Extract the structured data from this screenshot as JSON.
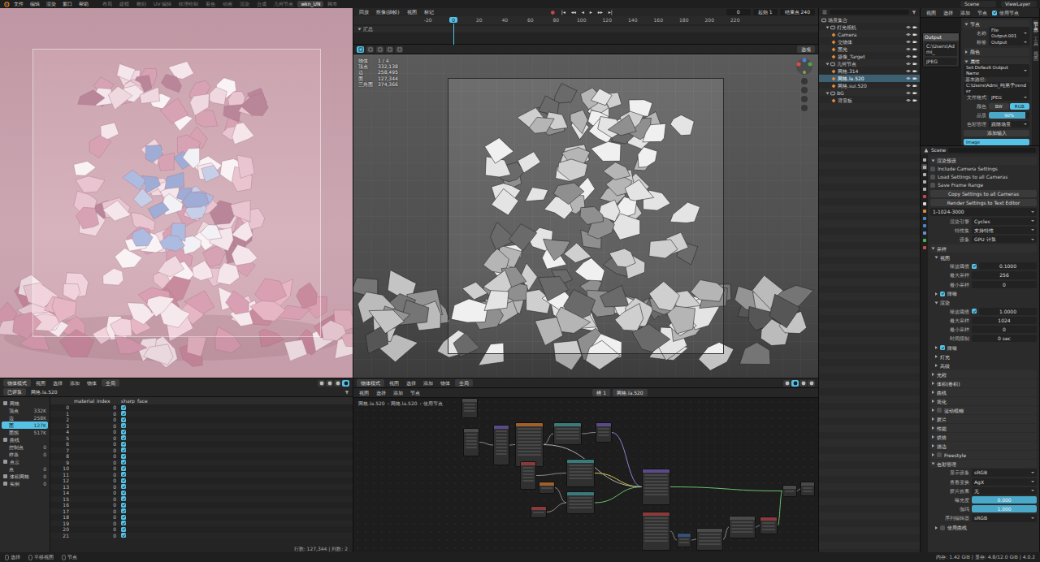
{
  "menubar": {
    "menus": [
      "文件",
      "编辑",
      "渲染",
      "窗口",
      "帮助"
    ],
    "workspaces": [
      {
        "label": "布局",
        "selected": false
      },
      {
        "label": "建模",
        "selected": false
      },
      {
        "label": "雕刻",
        "selected": false
      },
      {
        "label": "UV 编辑",
        "selected": false
      },
      {
        "label": "纹理绘制",
        "selected": false
      },
      {
        "label": "着色",
        "selected": false
      },
      {
        "label": "动画",
        "selected": false
      },
      {
        "label": "渲染",
        "selected": false
      },
      {
        "label": "合成",
        "selected": false
      },
      {
        "label": "几何节点",
        "selected": false
      },
      {
        "label": "wkn_UN",
        "selected": true
      },
      {
        "label": "脚本",
        "selected": false
      }
    ],
    "scene": "Scene",
    "view_layer": "ViewLayer"
  },
  "render_view": {
    "header": {
      "mode": "物体模式",
      "menus": [
        "视图",
        "选择",
        "添加",
        "物体"
      ],
      "orientation": "全局",
      "shading": [
        {
          "selected": false
        },
        {
          "selected": false
        },
        {
          "selected": false
        },
        {
          "selected": true
        }
      ]
    }
  },
  "timeline": {
    "menus": [
      "回放",
      "抠像(插帧)",
      "视图",
      "标记"
    ],
    "record": "●",
    "transport": [
      "|◂",
      "◂◂",
      "◂",
      "▸",
      "▸▸",
      "▸|"
    ],
    "current_frame": "0",
    "start_label": "起始",
    "start": "1",
    "end_label": "结束点",
    "end": "240",
    "summary": "汇总",
    "ruler": [
      {
        "label": "-20",
        "selected": false
      },
      {
        "label": "0",
        "selected": true
      },
      {
        "label": "20",
        "selected": false
      },
      {
        "label": "40",
        "selected": false
      },
      {
        "label": "60",
        "selected": false
      },
      {
        "label": "80",
        "selected": false
      },
      {
        "label": "100",
        "selected": false
      },
      {
        "label": "120",
        "selected": false
      },
      {
        "label": "140",
        "selected": false
      },
      {
        "label": "160",
        "selected": false
      },
      {
        "label": "180",
        "selected": false
      },
      {
        "label": "200",
        "selected": false
      },
      {
        "label": "220",
        "selected": false
      }
    ]
  },
  "viewport": {
    "header_tools": [
      {
        "selected": true
      },
      {
        "selected": false
      },
      {
        "selected": false
      },
      {
        "selected": false
      },
      {
        "selected": false
      }
    ],
    "options": "选项",
    "stats": [
      {
        "label": "物体",
        "value": "1 / 4"
      },
      {
        "label": "顶点",
        "value": "332,138"
      },
      {
        "label": "边",
        "value": "258,495"
      },
      {
        "label": "面",
        "value": "127,344"
      },
      {
        "label": "三角面",
        "value": "374,366"
      }
    ],
    "footer": {
      "mode": "物体模式",
      "menus": [
        "视图",
        "选择",
        "添加",
        "物体"
      ],
      "orientation": "全局",
      "shading": [
        {
          "selected": false
        },
        {
          "selected": true
        },
        {
          "selected": false
        },
        {
          "selected": false
        }
      ]
    }
  },
  "spreadsheet": {
    "header": {
      "mode": "已评算",
      "object": "网格.la.520"
    },
    "sidebar": [
      {
        "kind": "group",
        "label": "网格",
        "selected": false
      },
      {
        "kind": "item",
        "label": "顶点",
        "count": "332K",
        "selected": false
      },
      {
        "kind": "item",
        "label": "边",
        "count": "258K",
        "selected": false
      },
      {
        "kind": "item",
        "label": "面",
        "count": "127K",
        "selected": true
      },
      {
        "kind": "item",
        "label": "面拐",
        "count": "517K",
        "selected": false
      },
      {
        "kind": "group",
        "label": "曲线",
        "selected": false
      },
      {
        "kind": "item",
        "label": "控制点",
        "count": "0",
        "selected": false
      },
      {
        "kind": "item",
        "label": "样条",
        "count": "0",
        "selected": false
      },
      {
        "kind": "group",
        "label": "点云",
        "selected": false
      },
      {
        "kind": "item",
        "label": "点",
        "count": "0",
        "selected": false
      },
      {
        "kind": "group",
        "label": "体积网格",
        "count": "0",
        "selected": false
      },
      {
        "kind": "group",
        "label": "实例",
        "count": "0",
        "selected": false
      }
    ],
    "columns": [
      "material_index",
      "sharp_face"
    ],
    "rows": [
      {
        "index": "0",
        "material_index": "0",
        "sharp_face": true
      },
      {
        "index": "1",
        "material_index": "0",
        "sharp_face": true
      },
      {
        "index": "2",
        "material_index": "0",
        "sharp_face": true
      },
      {
        "index": "3",
        "material_index": "0",
        "sharp_face": true
      },
      {
        "index": "4",
        "material_index": "0",
        "sharp_face": true
      },
      {
        "index": "5",
        "material_index": "0",
        "sharp_face": true
      },
      {
        "index": "6",
        "material_index": "0",
        "sharp_face": true
      },
      {
        "index": "7",
        "material_index": "0",
        "sharp_face": true
      },
      {
        "index": "8",
        "material_index": "0",
        "sharp_face": true
      },
      {
        "index": "9",
        "material_index": "0",
        "sharp_face": true
      },
      {
        "index": "10",
        "material_index": "0",
        "sharp_face": true
      },
      {
        "index": "11",
        "material_index": "0",
        "sharp_face": true
      },
      {
        "index": "12",
        "material_index": "0",
        "sharp_face": true
      },
      {
        "index": "13",
        "material_index": "0",
        "sharp_face": true
      },
      {
        "index": "14",
        "material_index": "0",
        "sharp_face": true
      },
      {
        "index": "15",
        "material_index": "0",
        "sharp_face": true
      },
      {
        "index": "16",
        "material_index": "0",
        "sharp_face": true
      },
      {
        "index": "17",
        "material_index": "0",
        "sharp_face": true
      },
      {
        "index": "18",
        "material_index": "0",
        "sharp_face": true
      },
      {
        "index": "19",
        "material_index": "0",
        "sharp_face": true
      },
      {
        "index": "20",
        "material_index": "0",
        "sharp_face": true
      },
      {
        "index": "21",
        "material_index": "0",
        "sharp_face": true
      }
    ],
    "footer": "行数: 127,344 | 列数: 2"
  },
  "node_editor": {
    "menus": [
      "视图",
      "选择",
      "添加",
      "节点"
    ],
    "slot": "槽 1",
    "object": "网格.la.520",
    "breadcrumb": [
      "网格.la.520",
      "网格.la.520",
      "使用节点"
    ]
  },
  "outliner": {
    "rows": [
      {
        "kind": "scene",
        "label": "场景集合",
        "depth": 0,
        "selected": false
      },
      {
        "kind": "collection",
        "label": "灯光相机",
        "depth": 1,
        "expanded": true,
        "visible": true,
        "selected": false
      },
      {
        "kind": "object",
        "label": "Camera",
        "depth": 2,
        "visible": true,
        "selected": false
      },
      {
        "kind": "object",
        "label": "交物体",
        "depth": 2,
        "visible": true,
        "selected": false
      },
      {
        "kind": "object",
        "label": "面光",
        "depth": 2,
        "visible": true,
        "selected": false
      },
      {
        "kind": "object",
        "label": "摄像_Target",
        "depth": 2,
        "visible": true,
        "selected": false
      },
      {
        "kind": "collection",
        "label": "几何节点",
        "depth": 1,
        "expanded": true,
        "visible": true,
        "selected": false
      },
      {
        "kind": "object",
        "label": "网格.314",
        "depth": 2,
        "visible": true,
        "selected": false
      },
      {
        "kind": "object",
        "label": "网格.la.520",
        "depth": 2,
        "visible": true,
        "selected": true
      },
      {
        "kind": "object",
        "label": "网格.sui.520",
        "depth": 2,
        "visible": true,
        "selected": false
      },
      {
        "kind": "collection",
        "label": "BG",
        "depth": 1,
        "expanded": true,
        "visible": true,
        "selected": false
      },
      {
        "kind": "object",
        "label": "背景板",
        "depth": 2,
        "visible": true,
        "selected": false
      }
    ]
  },
  "node_side": {
    "menus": [
      "视图",
      "选择",
      "添加",
      "节点"
    ],
    "use_nodes": {
      "label": "使用节点",
      "checked": true
    },
    "mini_node": {
      "title": "Output",
      "path": "C:\\Users\\Admi_",
      "format": "JPEG"
    },
    "tabs": [
      {
        "label": "节点",
        "selected": true
      },
      {
        "label": "工具",
        "selected": false
      },
      {
        "label": "视图",
        "selected": false
      }
    ],
    "rows": [
      {
        "kind": "section",
        "label": "节点",
        "expanded": true
      },
      {
        "kind": "field",
        "label": "名称",
        "value": "File Output.001"
      },
      {
        "kind": "field",
        "label": "标签",
        "value": "Output"
      },
      {
        "kind": "section",
        "label": "颜色",
        "expanded": false
      },
      {
        "kind": "section",
        "label": "属性",
        "expanded": true
      },
      {
        "kind": "preset",
        "label": "Set Default Output Name"
      },
      {
        "kind": "label",
        "label": "基本路径:"
      },
      {
        "kind": "path",
        "label": "C:\\Users\\Admi_纯第子\\render"
      },
      {
        "kind": "field",
        "label": "文件格式",
        "value": "JPEG"
      },
      {
        "kind": "toggle",
        "label": "颜色",
        "options": [
          {
            "label": "BW",
            "selected": false
          },
          {
            "label": "RGB",
            "selected": true
          }
        ]
      },
      {
        "kind": "slider",
        "label": "品质",
        "value": "90%",
        "level": 0.9
      },
      {
        "kind": "field",
        "label": "色彩管理",
        "value": "跟随场景"
      },
      {
        "kind": "button",
        "label": "添加输入"
      },
      {
        "kind": "input",
        "label": "Image",
        "selected": true
      }
    ]
  },
  "properties": {
    "header": "Scene",
    "tabs": [
      {
        "selected": false,
        "color": "#b0b0b0"
      },
      {
        "selected": true,
        "color": "#b0b0b0"
      },
      {
        "selected": false,
        "color": "#b0b0b0"
      },
      {
        "selected": false,
        "color": "#b0b0b0"
      },
      {
        "selected": false,
        "color": "#b0b0b0"
      },
      {
        "selected": false,
        "color": "#c24a4a"
      },
      {
        "selected": false,
        "color": "#dcdcdc"
      },
      {
        "selected": false,
        "color": "#e08a3a"
      },
      {
        "selected": false,
        "color": "#4a86c8"
      },
      {
        "selected": false,
        "color": "#4a86c8"
      },
      {
        "selected": false,
        "color": "#6a8fd0"
      },
      {
        "selected": false,
        "color": "#4cb34c"
      },
      {
        "selected": false,
        "color": "#c0504d"
      }
    ],
    "rows": [
      {
        "kind": "section",
        "label": "渲染预设",
        "expanded": true
      },
      {
        "kind": "check",
        "label": "Include Camera Settings",
        "checked": false
      },
      {
        "kind": "check",
        "label": "Load Settings to all Cameras",
        "checked": false
      },
      {
        "kind": "check",
        "label": "Save Frame Range",
        "checked": false
      },
      {
        "kind": "button",
        "label": "Copy Settings to all Cameras"
      },
      {
        "kind": "button",
        "label": "Render Settings to Text Editor"
      },
      {
        "kind": "preset",
        "label": "1-1024-3000"
      },
      {
        "kind": "field",
        "label": "渲染引擎",
        "value": "Cycles"
      },
      {
        "kind": "field",
        "label": "特性集",
        "value": "支持特性"
      },
      {
        "kind": "field",
        "label": "设备",
        "value": "GPU 计算"
      },
      {
        "kind": "section",
        "label": "采样",
        "expanded": true
      },
      {
        "kind": "sub",
        "label": "视图",
        "expanded": true
      },
      {
        "kind": "number",
        "label": "噪波阈值",
        "value": "0.1000",
        "checked": true
      },
      {
        "kind": "number",
        "label": "最大采样",
        "value": "256"
      },
      {
        "kind": "number",
        "label": "最小采样",
        "value": "0"
      },
      {
        "kind": "sub",
        "label": "降噪",
        "expanded": false,
        "checked": true
      },
      {
        "kind": "sub",
        "label": "渲染",
        "expanded": true
      },
      {
        "kind": "number",
        "label": "噪波阈值",
        "value": "1.0000",
        "checked": true
      },
      {
        "kind": "number",
        "label": "最大采样",
        "value": "1024"
      },
      {
        "kind": "number",
        "label": "最小采样",
        "value": "0"
      },
      {
        "kind": "number",
        "label": "时间限制",
        "value": "0 sec"
      },
      {
        "kind": "sub",
        "label": "降噪",
        "expanded": false,
        "checked": true
      },
      {
        "kind": "sub",
        "label": "灯光",
        "expanded": false
      },
      {
        "kind": "sub",
        "label": "高级",
        "expanded": false
      },
      {
        "kind": "section",
        "label": "光程",
        "expanded": false
      },
      {
        "kind": "section",
        "label": "体积(卷积)",
        "expanded": false
      },
      {
        "kind": "section",
        "label": "曲线",
        "expanded": false
      },
      {
        "kind": "section",
        "label": "简化",
        "expanded": false
      },
      {
        "kind": "section",
        "label": "运动模糊",
        "expanded": false,
        "checked": false
      },
      {
        "kind": "section",
        "label": "胶片",
        "expanded": false
      },
      {
        "kind": "section",
        "label": "性能",
        "expanded": false
      },
      {
        "kind": "section",
        "label": "烘焙",
        "expanded": false
      },
      {
        "kind": "section",
        "label": "描边",
        "expanded": false
      },
      {
        "kind": "section",
        "label": "Freestyle",
        "expanded": false,
        "checked": false
      },
      {
        "kind": "section",
        "label": "色彩管理",
        "expanded": true
      },
      {
        "kind": "field",
        "label": "显示设备",
        "value": "sRGB"
      },
      {
        "kind": "field",
        "label": "查看变换",
        "value": "AgX"
      },
      {
        "kind": "field",
        "label": "胶片效果",
        "value": "无"
      },
      {
        "kind": "slider",
        "label": "曝光度",
        "value": "0.000",
        "level": 1
      },
      {
        "kind": "slider",
        "label": "伽玛",
        "value": "1.000",
        "level": 1
      },
      {
        "kind": "field",
        "label": "序列编辑器",
        "value": "sRGB"
      },
      {
        "kind": "sub",
        "label": "使用曲线",
        "expanded": false,
        "checked": false
      }
    ]
  },
  "status_bar": {
    "left": [
      "选择",
      "平移视图",
      "节点"
    ],
    "right": "内存: 1.42 GiB | 显存: 4.8/12.0 GiB | 4.0.2"
  }
}
